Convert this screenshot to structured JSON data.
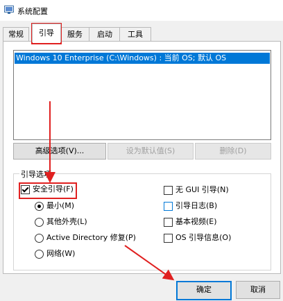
{
  "window": {
    "title": "系统配置"
  },
  "tabs": [
    "常规",
    "引导",
    "服务",
    "启动",
    "工具"
  ],
  "boot_list": {
    "items": [
      "Windows 10 Enterprise (C:\\Windows) : 当前 OS; 默认 OS"
    ]
  },
  "boot_buttons": {
    "advanced": "高级选项(V)...",
    "set_default": "设为默认值(S)",
    "delete": "删除(D)"
  },
  "boot_options": {
    "group_label": "引导选项",
    "safe_boot": {
      "label": "安全引导(F)",
      "checked": true
    },
    "radios": [
      {
        "label": "最小(M)",
        "checked": true
      },
      {
        "label": "其他外壳(L)",
        "checked": false
      },
      {
        "label": "Active Directory 修复(P)",
        "checked": false
      },
      {
        "label": "网络(W)",
        "checked": false
      }
    ],
    "right_checks": [
      {
        "label": "无 GUI 引导(N)",
        "checked": false
      },
      {
        "label": "引导日志(B)",
        "checked": false
      },
      {
        "label": "基本视频(E)",
        "checked": false
      },
      {
        "label": "OS 引导信息(O)",
        "checked": false
      }
    ]
  },
  "dialog_buttons": {
    "ok": "确定",
    "cancel": "取消"
  },
  "colors": {
    "selection": "#0078d7",
    "annotation": "#e02020"
  }
}
